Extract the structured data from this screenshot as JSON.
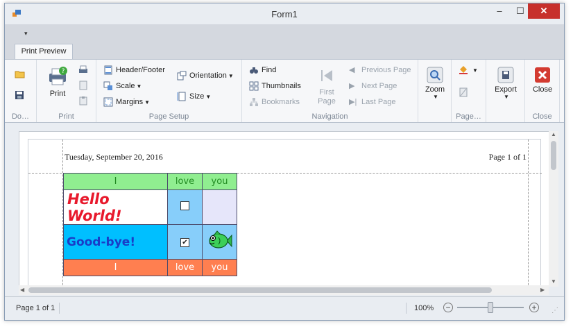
{
  "window": {
    "title": "Form1",
    "min_glyph": "–",
    "max_glyph": "☐",
    "close_glyph": "✕"
  },
  "qat": {
    "arrow": "▾"
  },
  "tab": {
    "label": "Print Preview"
  },
  "ribbon": {
    "document": {
      "label": "Do…"
    },
    "print": {
      "print_label": "Print",
      "group_label": "Print"
    },
    "page_setup": {
      "header_footer": "Header/Footer",
      "scale": "Scale",
      "margins": "Margins",
      "orientation": "Orientation",
      "size": "Size",
      "group_label": "Page Setup"
    },
    "navigation": {
      "find": "Find",
      "thumbnails": "Thumbnails",
      "bookmarks": "Bookmarks",
      "first_page": "First Page",
      "previous_page": "Previous Page",
      "next_page": "Next Page",
      "last_page": "Last Page",
      "group_label": "Navigation"
    },
    "zoom": {
      "label": "Zoom"
    },
    "page_bg": {
      "group_label": "Page…"
    },
    "export": {
      "label": "Export"
    },
    "close": {
      "label": "Close",
      "group_label": "Close"
    }
  },
  "document": {
    "header_date": "Tuesday, September 20, 2016",
    "header_page": "Page 1 of 1",
    "table": {
      "header": [
        "I",
        "love",
        "you"
      ],
      "row1_text": "Hello World!",
      "row1_checked": false,
      "row2_text": "Good-bye!",
      "row2_checked": true,
      "footer": [
        "I",
        "love",
        "you"
      ],
      "colors": {
        "header_bg": "#90ee90",
        "header_text": "#228b22",
        "row1_text": "#e8192c",
        "row1_bg": "#ffffff",
        "row2_bg": "#00bfff",
        "row2_text": "#1a3cc7",
        "check_col_bg": "#87cefa",
        "empty_cell_bg": "#e6e6fa",
        "footer_bg": "#ff7f50",
        "footer_text": "#ffffff"
      }
    }
  },
  "status": {
    "page_info": "Page 1 of 1",
    "zoom_level": "100%",
    "zoom_minus": "−",
    "zoom_plus": "+"
  }
}
